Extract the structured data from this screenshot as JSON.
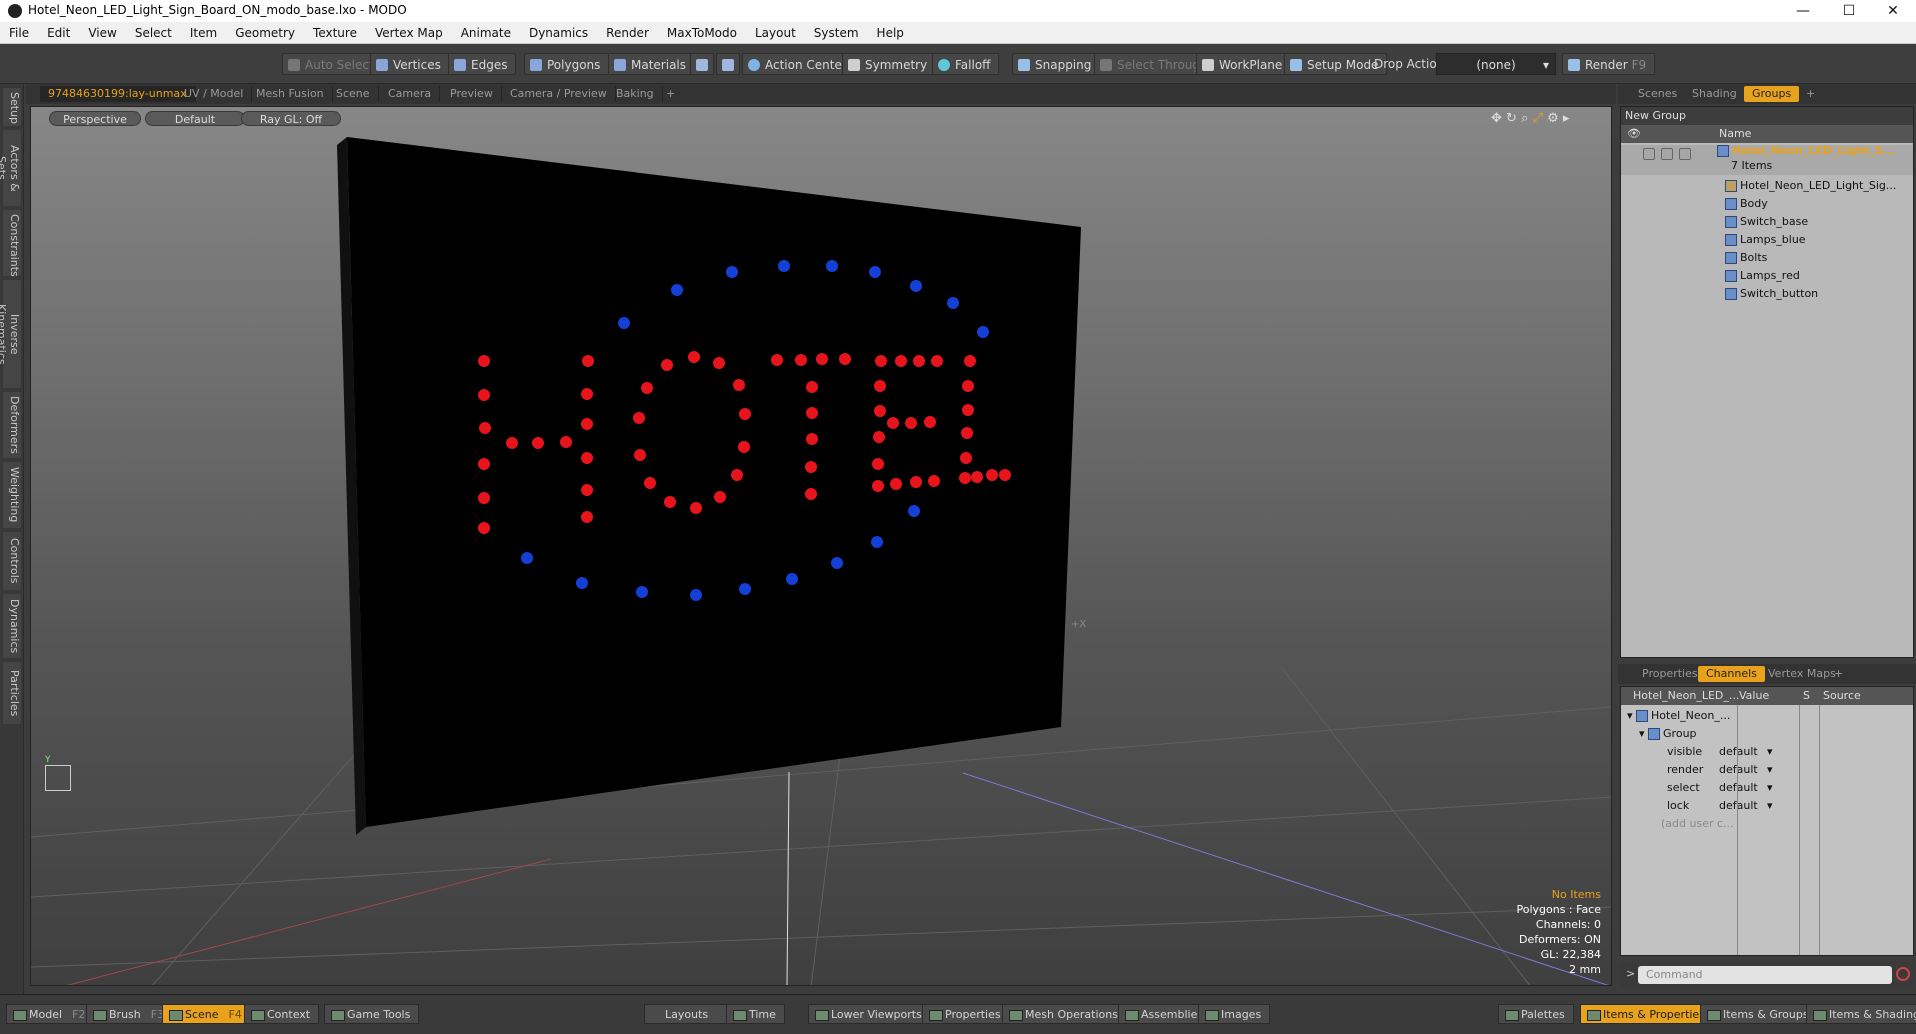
{
  "window": {
    "title": "Hotel_Neon_LED_Light_Sign_Board_ON_modo_base.lxo - MODO",
    "min": "—",
    "max": "☐",
    "close": "✕"
  },
  "menu": [
    "File",
    "Edit",
    "View",
    "Select",
    "Item",
    "Geometry",
    "Texture",
    "Vertex Map",
    "Animate",
    "Dynamics",
    "Render",
    "MaxToModo",
    "Layout",
    "System",
    "Help"
  ],
  "toolbar": {
    "auto_select": "Auto Select",
    "vertices": "Vertices",
    "edges": "Edges",
    "polygons": "Polygons",
    "materials": "Materials",
    "action_center": "Action Center",
    "symmetry": "Symmetry",
    "falloff": "Falloff",
    "snapping": "Snapping",
    "select_through": "Select Through",
    "workplane": "WorkPlane",
    "setup_mode": "Setup Mode",
    "drop_action": "Drop Action",
    "drop_value": "(none)",
    "render": "Render",
    "render_key": "F9"
  },
  "left_tabs": [
    "Setup",
    "Actors & Sets",
    "Constraints",
    "Inverse Kinematics",
    "Deformers",
    "Weighting",
    "Controls",
    "Dynamics",
    "Particles"
  ],
  "viewport_tabs": [
    "97484630199:lay-unmax",
    "UV / Model",
    "Mesh Fusion",
    "Scene",
    "Camera",
    "Preview",
    "Camera / Preview",
    "Baking",
    "+"
  ],
  "viewport": {
    "view_mode": "Perspective",
    "shading": "Default",
    "raygl": "Ray GL: Off",
    "axis_x_label": "+X",
    "axis_y_label": "Y",
    "info": {
      "items": "No Items",
      "polygons": "Polygons : Face",
      "channels": "Channels: 0",
      "deformers": "Deformers: ON",
      "gl": "GL: 22,384",
      "grid": "2 mm"
    }
  },
  "right_tabs": [
    "Scenes",
    "Shading",
    "Groups",
    "+"
  ],
  "groups": {
    "new_group": "New Group",
    "col_name": "Name",
    "root": "Hotel_Neon_LED_Light_S...",
    "count": "7 Items",
    "items": [
      "Hotel_Neon_LED_Light_Sig...",
      "Body",
      "Switch_base",
      "Lamps_blue",
      "Bolts",
      "Lamps_red",
      "Switch_button"
    ]
  },
  "prop_tabs": [
    "Properties",
    "Channels",
    "Vertex Maps",
    "+"
  ],
  "channels": {
    "col_item": "Hotel_Neon_LED_...",
    "col_value": "Value",
    "col_s": "S",
    "col_source": "Source",
    "root": "Hotel_Neon_...",
    "group": "Group",
    "rows": [
      {
        "name": "visible",
        "value": "default"
      },
      {
        "name": "render",
        "value": "default"
      },
      {
        "name": "select",
        "value": "default"
      },
      {
        "name": "lock",
        "value": "default"
      }
    ],
    "add": "(add user c..."
  },
  "command": {
    "placeholder": "Command"
  },
  "bottom": {
    "model": "Model",
    "model_key": "F2",
    "brush": "Brush",
    "brush_key": "F3",
    "scene": "Scene",
    "scene_key": "F4",
    "context": "Context",
    "game_tools": "Game Tools",
    "layouts": "Layouts",
    "time": "Time",
    "lower_viewports": "Lower Viewports",
    "properties": "Properties",
    "mesh_operations": "Mesh Operations",
    "assemblies": "Assemblies",
    "images": "Images",
    "palettes": "Palettes",
    "items_properties": "Items & Properties",
    "items_groups": "Items & Groups",
    "items_shading": "Items & Shading"
  },
  "colors": {
    "accent": "#e8a21b",
    "led_red": "#e8141c",
    "led_blue": "#1440d8"
  }
}
